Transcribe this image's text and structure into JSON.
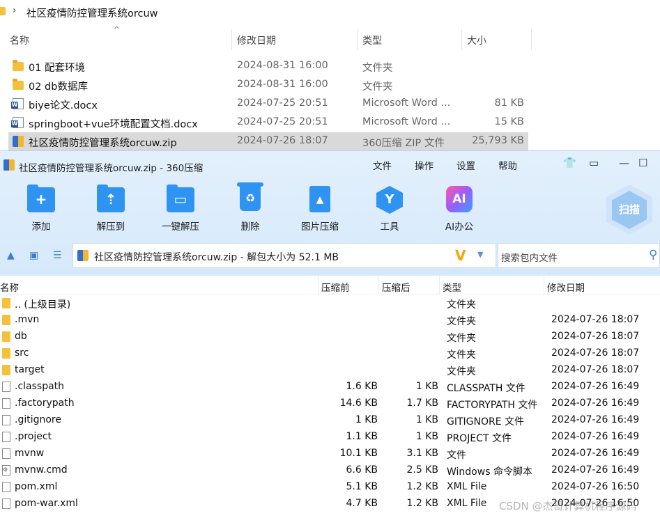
{
  "explorer": {
    "path_title": "社区疫情防控管理系统orcuw",
    "columns": {
      "name": "名称",
      "date": "修改日期",
      "type": "类型",
      "size": "大小"
    },
    "rows": [
      {
        "icon": "folder-icon",
        "name": "01 配套环境",
        "date": "2024-08-31 16:00",
        "type": "文件夹",
        "size": ""
      },
      {
        "icon": "folder-icon",
        "name": "02 db数据库",
        "date": "2024-08-31 16:00",
        "type": "文件夹",
        "size": ""
      },
      {
        "icon": "word-doc-icon",
        "name": "biye论文.docx",
        "date": "2024-07-25 20:51",
        "type": "Microsoft Word ...",
        "size": "81 KB"
      },
      {
        "icon": "word-doc-icon",
        "name": "springboot+vue环境配置文档.docx",
        "date": "2024-07-25 20:51",
        "type": "Microsoft Word ...",
        "size": "15 KB"
      },
      {
        "icon": "zip-icon",
        "name": "社区疫情防控管理系统orcuw.zip",
        "date": "2024-07-26 18:07",
        "type": "360压缩 ZIP 文件",
        "size": "25,793 KB",
        "selected": true
      }
    ]
  },
  "zipwin": {
    "title": "社区疫情防控管理系统orcuw.zip - 360压缩",
    "menu": [
      "文件",
      "操作",
      "设置",
      "帮助"
    ],
    "toolbar": [
      "添加",
      "解压到",
      "一键解压",
      "删除",
      "图片压缩",
      "工具",
      "AI办公"
    ],
    "scan_label": "扫描",
    "address": "社区疫情防控管理系统orcuw.zip - 解包大小为 52.1 MB",
    "search_placeholder": "搜索包内文件",
    "columns": {
      "name": "名称",
      "packed": "压缩前",
      "unpacked": "压缩后",
      "type": "类型",
      "date": "修改日期"
    },
    "rows": [
      {
        "icon": "folder-icon",
        "name": ".. (上级目录)",
        "packed": "",
        "unpacked": "",
        "type": "文件夹",
        "date": ""
      },
      {
        "icon": "folder-icon",
        "name": ".mvn",
        "packed": "",
        "unpacked": "",
        "type": "文件夹",
        "date": "2024-07-26 18:07"
      },
      {
        "icon": "folder-icon",
        "name": "db",
        "packed": "",
        "unpacked": "",
        "type": "文件夹",
        "date": "2024-07-26 18:07"
      },
      {
        "icon": "folder-icon",
        "name": "src",
        "packed": "",
        "unpacked": "",
        "type": "文件夹",
        "date": "2024-07-26 18:07"
      },
      {
        "icon": "folder-icon",
        "name": "target",
        "packed": "",
        "unpacked": "",
        "type": "文件夹",
        "date": "2024-07-26 18:07"
      },
      {
        "icon": "file-icon",
        "name": ".classpath",
        "packed": "1.6 KB",
        "unpacked": "1 KB",
        "type": "CLASSPATH 文件",
        "date": "2024-07-26 16:49"
      },
      {
        "icon": "file-icon",
        "name": ".factorypath",
        "packed": "14.6 KB",
        "unpacked": "1.7 KB",
        "type": "FACTORYPATH 文件",
        "date": "2024-07-26 16:49"
      },
      {
        "icon": "file-icon",
        "name": ".gitignore",
        "packed": "1 KB",
        "unpacked": "1 KB",
        "type": "GITIGNORE 文件",
        "date": "2024-07-26 16:49"
      },
      {
        "icon": "file-icon",
        "name": ".project",
        "packed": "1.1 KB",
        "unpacked": "1 KB",
        "type": "PROJECT 文件",
        "date": "2024-07-26 16:49"
      },
      {
        "icon": "file-icon",
        "name": "mvnw",
        "packed": "10.1 KB",
        "unpacked": "3.1 KB",
        "type": "文件",
        "date": "2024-07-26 16:49"
      },
      {
        "icon": "cmd-file-icon",
        "name": "mvnw.cmd",
        "packed": "6.6 KB",
        "unpacked": "2.5 KB",
        "type": "Windows 命令脚本",
        "date": "2024-07-26 16:49"
      },
      {
        "icon": "file-icon",
        "name": "pom.xml",
        "packed": "5.1 KB",
        "unpacked": "1.2 KB",
        "type": "XML File",
        "date": "2024-07-26 16:50"
      },
      {
        "icon": "file-icon",
        "name": "pom-war.xml",
        "packed": "4.7 KB",
        "unpacked": "1.2 KB",
        "type": "XML File",
        "date": "2024-07-26 16:50"
      }
    ]
  },
  "watermark": "CSDN @杰哥计算机程序源码",
  "colors": {
    "accent": "#2f93f2",
    "toolbar_bg": "#d6e9fb",
    "selected_row": "#d9d9d9",
    "folder": "#f3c13a"
  }
}
